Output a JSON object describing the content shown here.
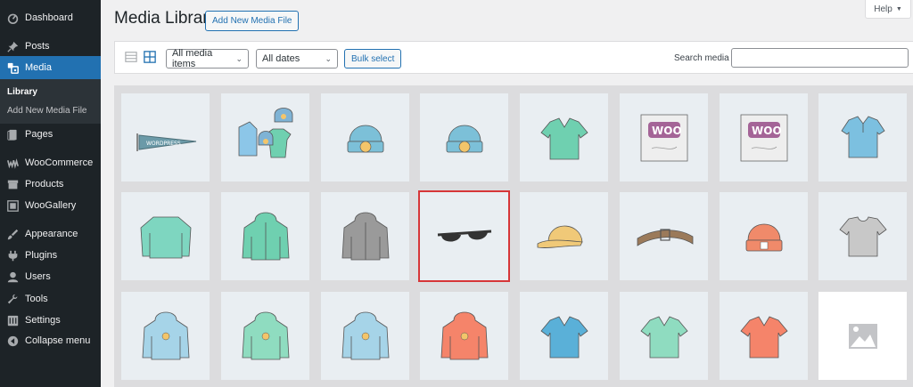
{
  "sidebar": {
    "items": [
      {
        "label": "Dashboard",
        "icon": "dashboard-icon"
      },
      {
        "label": "Posts",
        "icon": "pin-icon"
      },
      {
        "label": "Media",
        "icon": "media-icon"
      },
      {
        "label": "Pages",
        "icon": "page-icon"
      },
      {
        "label": "WooCommerce",
        "icon": "woo-icon"
      },
      {
        "label": "Products",
        "icon": "archive-icon"
      },
      {
        "label": "WooGallery",
        "icon": "gallery-icon"
      },
      {
        "label": "Appearance",
        "icon": "brush-icon"
      },
      {
        "label": "Plugins",
        "icon": "plugin-icon"
      },
      {
        "label": "Users",
        "icon": "user-icon"
      },
      {
        "label": "Tools",
        "icon": "wrench-icon"
      },
      {
        "label": "Settings",
        "icon": "settings-icon"
      },
      {
        "label": "Collapse menu",
        "icon": "collapse-icon"
      }
    ],
    "submenu": {
      "library": "Library",
      "add_new": "Add New Media File"
    }
  },
  "header": {
    "title": "Media Library",
    "add_new_label": "Add New Media File",
    "help_label": "Help",
    "help_chevron": "▼"
  },
  "toolbar": {
    "filter_type": {
      "selected": "All media items"
    },
    "filter_date": {
      "selected": "All dates"
    },
    "bulk_select_label": "Bulk select",
    "search_label": "Search media",
    "search_value": ""
  },
  "grid": {
    "items": [
      {
        "kind": "pennant",
        "color": "#6b9aa8"
      },
      {
        "kind": "bundle",
        "color": "#7fb3d5"
      },
      {
        "kind": "beanie",
        "color": "#7cc0d8"
      },
      {
        "kind": "beanie",
        "color": "#7cc0d8"
      },
      {
        "kind": "vneck",
        "color": "#6fd0b0"
      },
      {
        "kind": "woo-single",
        "color": "#a46497"
      },
      {
        "kind": "woo-album",
        "color": "#a46497"
      },
      {
        "kind": "polo",
        "color": "#7cc0e0"
      },
      {
        "kind": "longsleeve",
        "color": "#7ed6c0"
      },
      {
        "kind": "hoodie-zip",
        "color": "#6fd0b0"
      },
      {
        "kind": "hoodie",
        "color": "#9a9a9a"
      },
      {
        "kind": "sunglasses",
        "color": "#333333"
      },
      {
        "kind": "cap",
        "color": "#f0c978"
      },
      {
        "kind": "belt",
        "color": "#9b7a5a"
      },
      {
        "kind": "beanie-red",
        "color": "#f08a6a"
      },
      {
        "kind": "tshirt",
        "color": "#c8c8c8"
      },
      {
        "kind": "hoodie-logo",
        "color": "#a6d4e8"
      },
      {
        "kind": "hoodie-logo",
        "color": "#8fdcc0"
      },
      {
        "kind": "hoodie-logo",
        "color": "#a6d4e8"
      },
      {
        "kind": "hoodie-logo",
        "color": "#f5846a"
      },
      {
        "kind": "vneck",
        "color": "#5ab0d8"
      },
      {
        "kind": "vneck",
        "color": "#8fdcc0"
      },
      {
        "kind": "vneck",
        "color": "#f5846a"
      },
      {
        "kind": "placeholder",
        "color": "#c3c4c7"
      }
    ],
    "selected_index": 11
  },
  "colors": {
    "sidebar_bg": "#1d2327",
    "accent": "#2271b1",
    "highlight": "#d63638"
  }
}
